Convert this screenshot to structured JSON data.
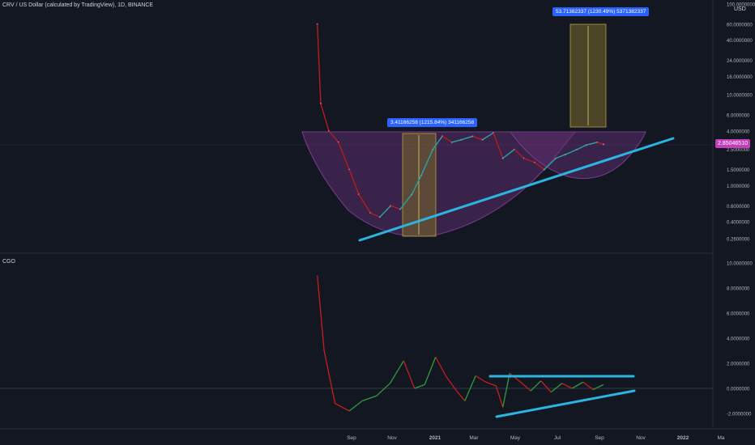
{
  "header": {
    "symbol_title": "CRV / US Dollar (calculated by TradingView), 1D, BINANCE",
    "indicator_title": "CGO",
    "currency": "USD"
  },
  "price_axis": {
    "ticks": [
      "100.0000000",
      "60.0000000",
      "40.0000000",
      "24.0000000",
      "16.0000000",
      "10.0000000",
      "6.0000000",
      "4.0000000",
      "2.5000000",
      "1.5000000",
      "1.0000000",
      "0.6000000",
      "0.4000000",
      "0.2600000"
    ],
    "current_price": "2.85046510"
  },
  "oscillator_axis": {
    "ticks": [
      "10.0000000",
      "8.0000000",
      "6.0000000",
      "4.0000000",
      "2.0000000",
      "0.0000000",
      "-2.0000000"
    ]
  },
  "time_axis": {
    "ticks": [
      "Sep",
      "Nov",
      "2021",
      "Mar",
      "May",
      "Jul",
      "Sep",
      "Nov",
      "2022",
      "Ma"
    ]
  },
  "annotations": {
    "measure_small": "3.41166258 (1215.84%) 341166258",
    "measure_large": "53.71382337 (1230.49%) 5371382337"
  },
  "colors": {
    "background": "#131722",
    "trendline": "#2bb5e0",
    "cup_fill": "#5b2d6e",
    "measure_fill": "#7a6a2a",
    "up": "#26a69a",
    "down": "#b71c1c",
    "price_tag": "#c53fbc"
  },
  "chart_data": [
    {
      "type": "candlestick",
      "title": "CRV / US Dollar (calculated by TradingView), 1D, BINANCE",
      "scale": "log",
      "x": [
        "2020-08-15",
        "2020-08-20",
        "2020-09-01",
        "2020-09-15",
        "2020-10-01",
        "2020-10-15",
        "2020-11-01",
        "2020-11-15",
        "2020-12-01",
        "2020-12-15",
        "2021-01-01",
        "2021-01-15",
        "2021-02-01",
        "2021-02-15",
        "2021-03-01",
        "2021-03-15",
        "2021-04-01",
        "2021-04-15",
        "2021-05-01",
        "2021-05-15",
        "2021-06-01",
        "2021-06-15",
        "2021-07-01",
        "2021-07-15",
        "2021-08-01",
        "2021-08-15",
        "2021-09-01",
        "2021-09-15",
        "2021-10-01",
        "2021-10-10"
      ],
      "values": [
        60.0,
        8.0,
        4.0,
        3.0,
        1.5,
        0.8,
        0.5,
        0.45,
        0.6,
        0.55,
        0.8,
        1.3,
        2.5,
        3.5,
        3.0,
        3.2,
        3.5,
        3.2,
        3.8,
        2.0,
        2.5,
        2.0,
        1.8,
        1.5,
        2.0,
        2.2,
        2.5,
        2.8,
        3.0,
        2.85
      ],
      "ylim": [
        0.26,
        100
      ],
      "current_price": 2.8504651
    },
    {
      "type": "line",
      "title": "CGO",
      "x": [
        "2020-08-15",
        "2020-08-25",
        "2020-09-10",
        "2020-10-01",
        "2020-10-20",
        "2020-11-10",
        "2020-11-30",
        "2020-12-20",
        "2021-01-05",
        "2021-01-20",
        "2021-02-05",
        "2021-02-20",
        "2021-03-05",
        "2021-03-20",
        "2021-04-05",
        "2021-04-20",
        "2021-05-05",
        "2021-05-15",
        "2021-05-25",
        "2021-06-10",
        "2021-06-25",
        "2021-07-10",
        "2021-07-25",
        "2021-08-10",
        "2021-08-25",
        "2021-09-10",
        "2021-09-25",
        "2021-10-10"
      ],
      "values": [
        9.0,
        3.0,
        -1.2,
        -1.8,
        -1.0,
        -0.6,
        0.4,
        2.2,
        0.0,
        0.3,
        2.5,
        1.0,
        0.0,
        -1.0,
        1.0,
        0.5,
        0.2,
        -1.5,
        1.2,
        0.5,
        -0.2,
        0.6,
        -0.3,
        0.4,
        0.0,
        0.5,
        -0.1,
        0.3
      ],
      "ylim": [
        -3,
        11
      ]
    }
  ]
}
